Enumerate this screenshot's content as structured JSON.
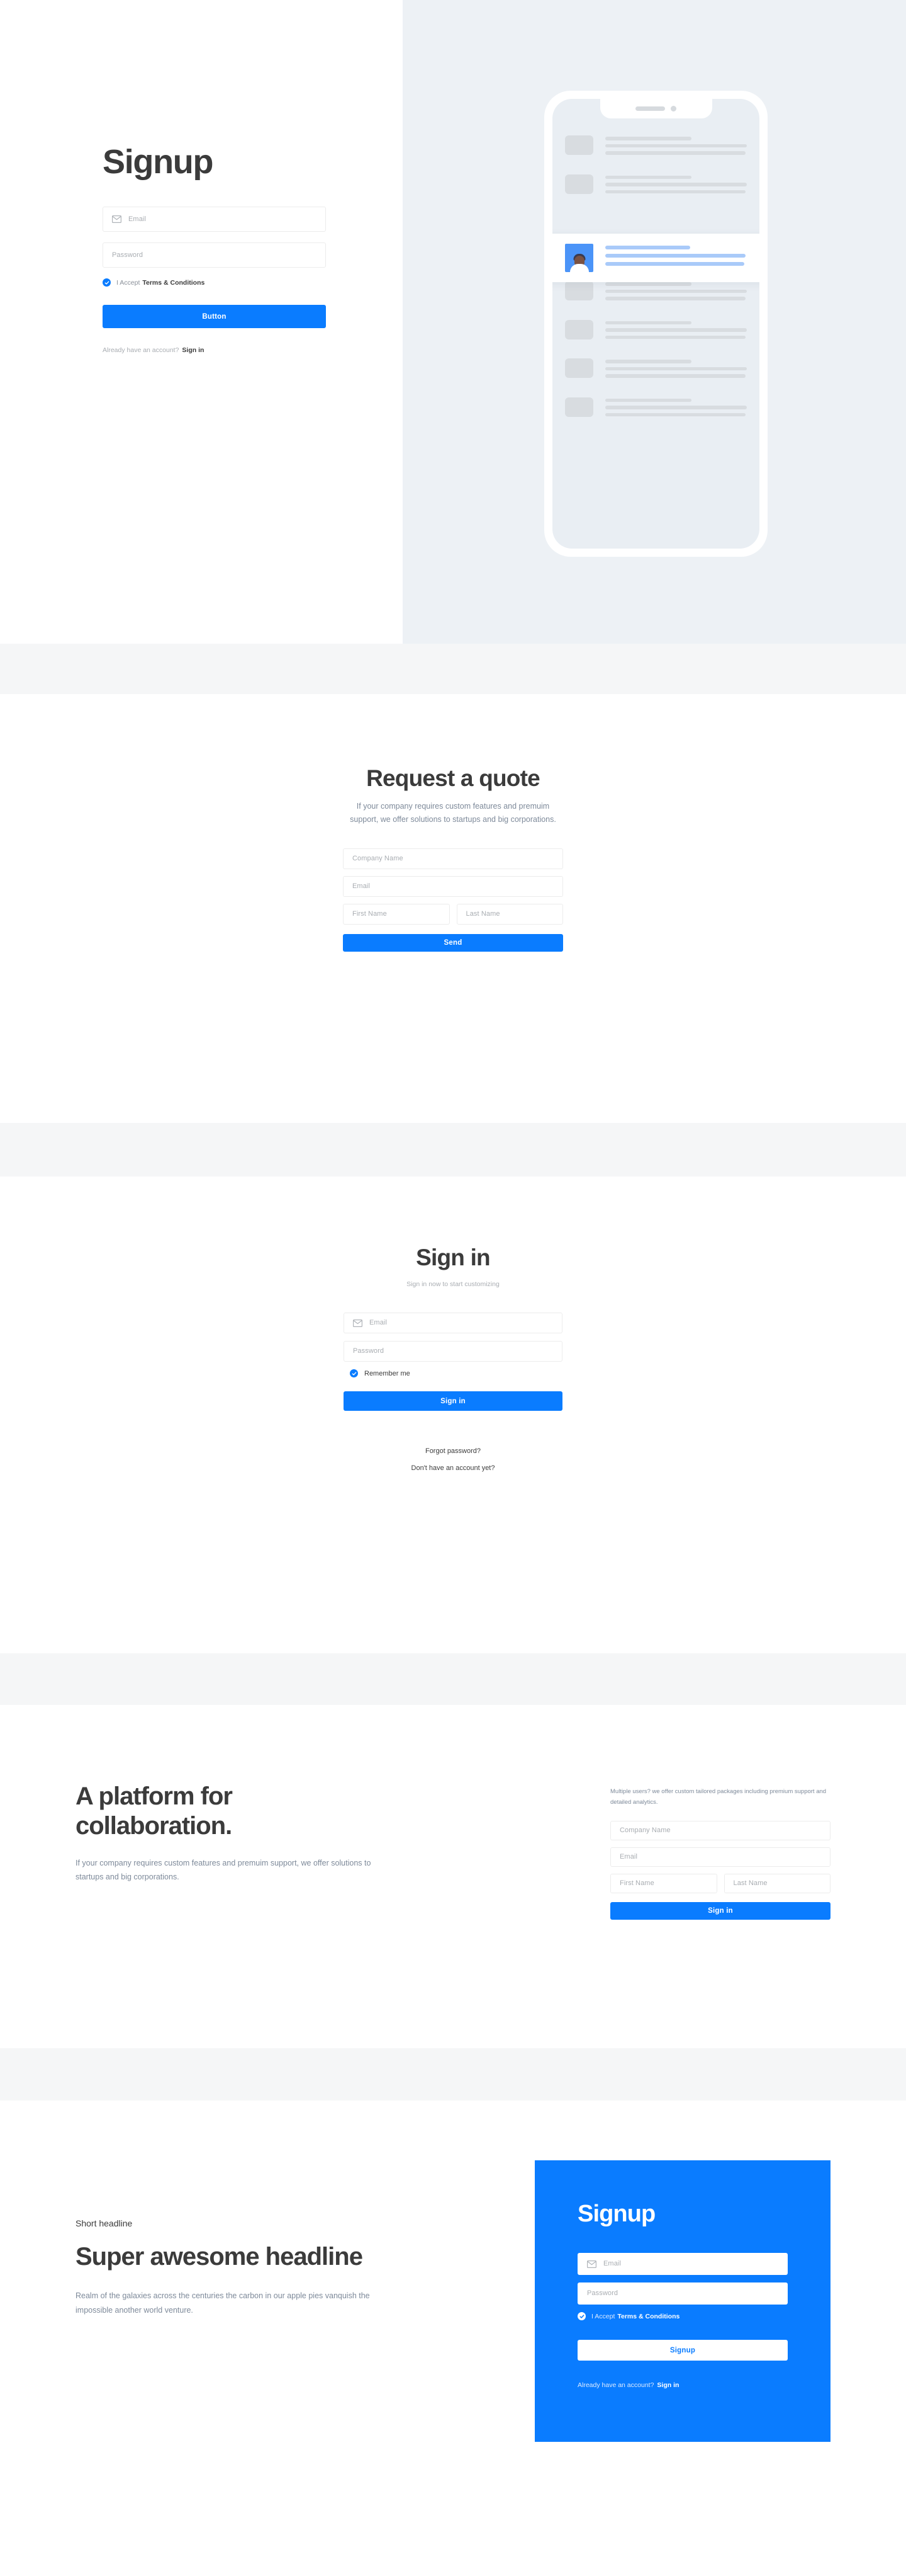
{
  "theme": {
    "accent": "#0a7cff",
    "page_bg": "#f5f6f7",
    "hero_right_bg": "#edf1f5",
    "heading_color": "#3b3b3b",
    "muted_color": "#7e8a9a"
  },
  "signup_hero": {
    "title": "Signup",
    "email_placeholder": "Email",
    "password_placeholder": "Password",
    "accept_prefix": "I Accept",
    "accept_link": "Terms & Conditions",
    "submit_label": "Button",
    "footer_text": "Already have an account?",
    "footer_link": "Sign in",
    "mail_icon": "mail-icon",
    "check_icon": "check-icon"
  },
  "quote": {
    "title": "Request a quote",
    "subtitle": "If your company requires custom features and premuim support, we offer solutions to startups and big corporations.",
    "company_placeholder": "Company Name",
    "email_placeholder": "Email",
    "first_name_placeholder": "First Name",
    "last_name_placeholder": "Last Name",
    "submit_label": "Send"
  },
  "signin": {
    "title": "Sign in",
    "subtitle": "Sign in now to start customizing",
    "email_placeholder": "Email",
    "password_placeholder": "Password",
    "remember_label": "Remember me",
    "submit_label": "Sign in",
    "forgot_link": "Forgot password?",
    "no_account_link": "Don't have an account yet?",
    "mail_icon": "mail-icon",
    "check_icon": "check-icon"
  },
  "platform": {
    "title": "A platform for collaboration.",
    "body": "If your company requires custom features and premuim support, we offer solutions to startups and big corporations.",
    "note": "Multiple users? we offer custom tailored packages including premium support and detailed analytics.",
    "company_placeholder": "Company Name",
    "email_placeholder": "Email",
    "first_name_placeholder": "First Name",
    "last_name_placeholder": "Last Name",
    "submit_label": "Sign in"
  },
  "headline": {
    "kicker": "Short headline",
    "title": "Super awesome headline",
    "body": "Realm of the galaxies across the centuries the carbon in our apple pies vanquish the impossible another world venture.",
    "card": {
      "title": "Signup",
      "email_placeholder": "Email",
      "password_placeholder": "Password",
      "accept_prefix": "I Accept",
      "accept_link": "Terms & Conditions",
      "submit_label": "Signup",
      "footer_text": "Already have an account?",
      "footer_link": "Sign in",
      "mail_icon": "mail-icon",
      "check_icon": "check-icon"
    }
  }
}
